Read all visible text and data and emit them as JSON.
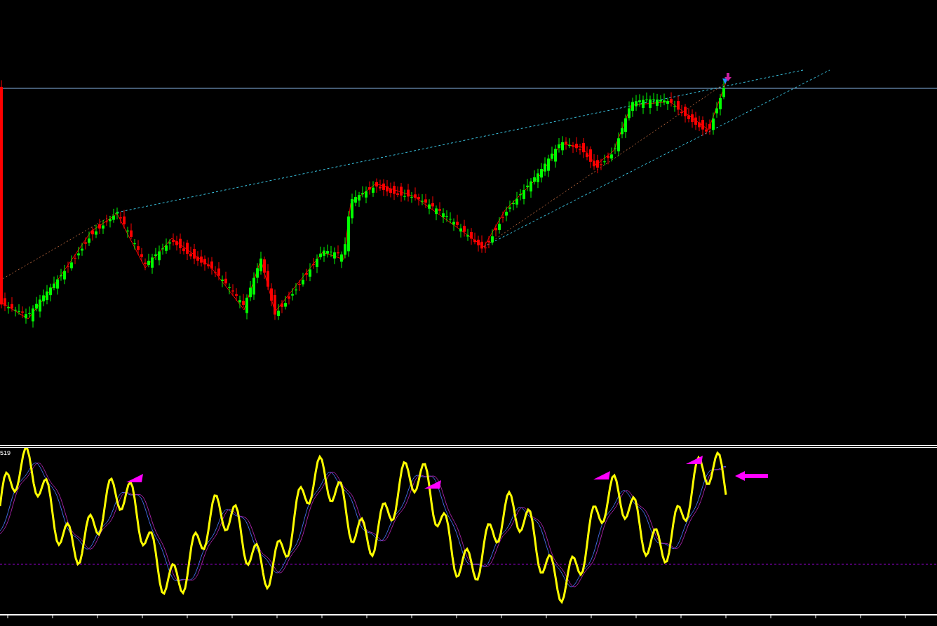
{
  "indicator": {
    "label": "519"
  }
}
